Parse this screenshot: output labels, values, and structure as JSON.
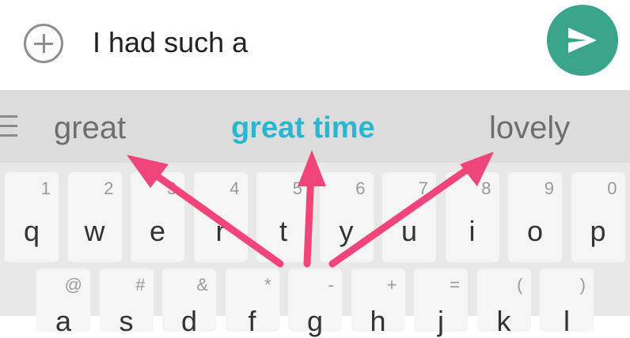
{
  "compose": {
    "message_text": "I had such a",
    "add_icon": "plus-circle-icon",
    "send_icon": "send-icon",
    "send_color": "#3aa58a"
  },
  "suggestions": {
    "menu_icon": "hamburger-menu-icon",
    "left": "great",
    "center": "great time",
    "right": "lovely",
    "center_color": "#2bb6cf"
  },
  "keyboard": {
    "row1": [
      {
        "letter": "q",
        "hint": "1"
      },
      {
        "letter": "w",
        "hint": "2"
      },
      {
        "letter": "e",
        "hint": "3"
      },
      {
        "letter": "r",
        "hint": "4"
      },
      {
        "letter": "t",
        "hint": "5"
      },
      {
        "letter": "y",
        "hint": "6"
      },
      {
        "letter": "u",
        "hint": "7"
      },
      {
        "letter": "i",
        "hint": "8"
      },
      {
        "letter": "o",
        "hint": "9"
      },
      {
        "letter": "p",
        "hint": "0"
      }
    ],
    "row2": [
      {
        "letter": "a",
        "hint": "@"
      },
      {
        "letter": "s",
        "hint": "#"
      },
      {
        "letter": "d",
        "hint": "&"
      },
      {
        "letter": "f",
        "hint": "*"
      },
      {
        "letter": "g",
        "hint": "-"
      },
      {
        "letter": "h",
        "hint": "+"
      },
      {
        "letter": "j",
        "hint": "="
      },
      {
        "letter": "k",
        "hint": "("
      },
      {
        "letter": "l",
        "hint": ")"
      }
    ]
  },
  "annotation": {
    "arrow_color": "#f0457a"
  }
}
